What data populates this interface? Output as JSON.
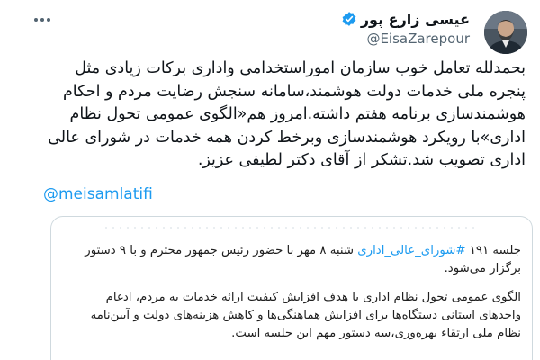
{
  "author": {
    "name": "عیسی زارع پور",
    "handle": "@EisaZarepour",
    "verified": true
  },
  "tweet": {
    "text": "بحمدلله تعامل خوب سازمان اموراستخدامی واداری برکات زیادی مثل\nپنجره ملی خدمات دولت هوشمند،سامانه سنجش رضایت مردم و احکام\nهوشمندسازی برنامه هفتم داشته.امروز هم«الگوی عمومی تحول نظام\nاداری»با رویکرد هوشمندسازی وبرخط کردن همه خدمات در شورای عالی\nاداری تصویب شد.تشکر از آقای دکتر لطیفی عزیز.",
    "mention": "@meisamlatifi"
  },
  "quote": {
    "para1_before": "جلسه ۱۹۱ ",
    "para1_hashtag": "#شورای_عالی_اداری",
    "para1_after": " شنبه ۸ مهر با حضور رئیس جمهور محترم و با ۹ دستور برگزار می‌شود.",
    "para2": "الگوی عمومی تحول نظام اداری با هدف افزایش کیفیت ارائه خدمات به مردم، ادغام واحدهای استانی دستگاه‌ها برای افزایش هماهنگی‌ها و کاهش هزینه‌های دولت و آیین‌نامه نظام ملی ارتقاء بهره‌وری،سه دستور مهم این جلسه است."
  },
  "colors": {
    "link": "#1d9bf0",
    "verified": "#1d9bf0",
    "border": "#cfd9de",
    "secondary_text": "#536471"
  },
  "icons": {
    "more": "more-horizontal-icon",
    "verified": "verified-badge-icon"
  }
}
